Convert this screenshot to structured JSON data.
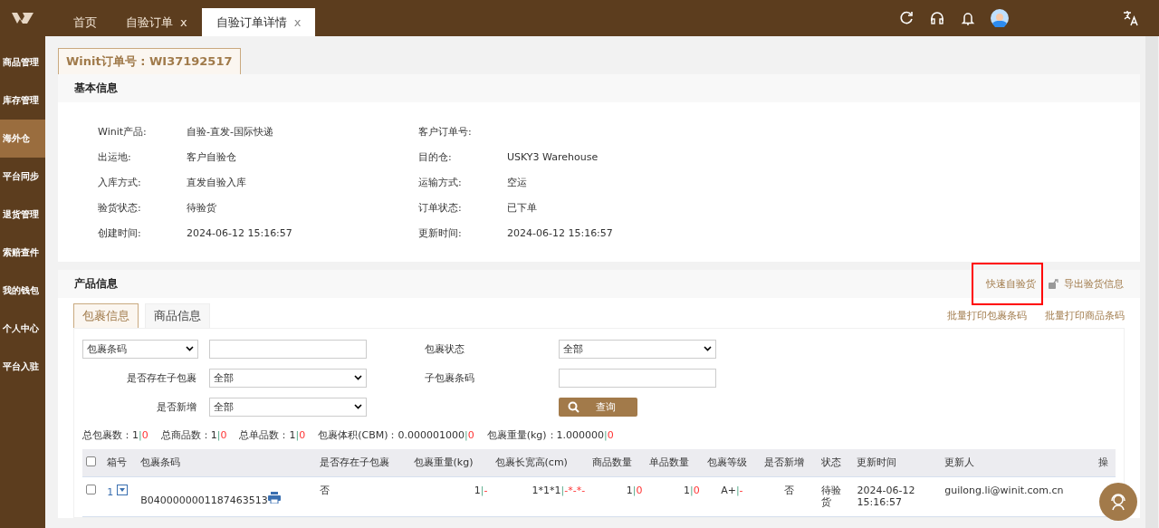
{
  "top_tabs": [
    {
      "label": "首页",
      "selected": false
    },
    {
      "label": "自验订单",
      "close": "x",
      "selected": false
    },
    {
      "label": "自验订单详情",
      "close": "x",
      "selected": true
    }
  ],
  "sidebar": {
    "items": [
      {
        "label": "商品管理",
        "selected": false
      },
      {
        "label": "库存管理",
        "selected": false
      },
      {
        "label": "海外仓",
        "selected": true
      },
      {
        "label": "平台同步",
        "selected": false
      },
      {
        "label": "退货管理",
        "selected": false
      },
      {
        "label": "索赔查件",
        "selected": false
      },
      {
        "label": "我的钱包",
        "selected": false
      },
      {
        "label": "个人中心",
        "selected": false
      },
      {
        "label": "平台入驻",
        "selected": false
      }
    ]
  },
  "order_tab": "Winit订单号 : WI37192517",
  "basic_info": {
    "title": "基本信息",
    "fields": [
      {
        "label": "Winit产品:",
        "value": "自验-直发-国际快递"
      },
      {
        "label": "客户订单号:"
      },
      {
        "label": "出运地:",
        "value": "客户自验仓"
      },
      {
        "label": "目的仓:",
        "value": "USKY3 Warehouse"
      },
      {
        "label": "入库方式:",
        "value": "直发自验入库"
      },
      {
        "label": "运输方式:",
        "value": "空运"
      },
      {
        "label": "验货状态:",
        "value": "待验货"
      },
      {
        "label": "订单状态:",
        "value": "已下单"
      },
      {
        "label": "创建时间:",
        "value": "2024-06-12 15:16:57"
      },
      {
        "label": "更新时间:",
        "value": "2024-06-12 15:16:57"
      }
    ]
  },
  "product_info": {
    "title": "产品信息",
    "actions": [
      {
        "label": "快速自验货",
        "kind": "plain",
        "highlighted": true
      },
      {
        "label": "导出验货信息",
        "kind": "export",
        "highlighted": false
      }
    ],
    "sub_tabs": [
      {
        "label": "包裹信息",
        "selected": true
      },
      {
        "label": "商品信息",
        "selected": false
      }
    ],
    "print_links": [
      "批量打印包裹条码",
      "批量打印商品条码"
    ],
    "filters": {
      "search_type": "包裹条码",
      "package_status_label": "包裹状态",
      "package_status": "全部",
      "has_sub_label": "是否存在子包裹",
      "has_sub": "全部",
      "sub_barcode_label": "子包裹条码",
      "is_new_label": "是否新增",
      "is_new": "全部",
      "query_button": "查询"
    },
    "stats": [
      {
        "label": "总包裹数：",
        "value": "1",
        "sep": "|",
        "delta": "0"
      },
      {
        "label": "总商品数：",
        "value": "1",
        "sep": "|",
        "delta": "0"
      },
      {
        "label": "总单品数：",
        "value": "1",
        "sep": "|",
        "delta": "0"
      },
      {
        "label": "包裹体积(CBM)：",
        "value": "0.000001000",
        "sep": "|",
        "delta": "0"
      },
      {
        "label": "包裹重量(kg)：",
        "value": "1.000000",
        "sep": "|",
        "delta": "0"
      }
    ],
    "table": {
      "select_all_checked": false,
      "columns": [
        "箱号",
        "包裹条码",
        "是否存在子包裹",
        "包裹重量(kg)",
        "包裹长宽高(cm)",
        "商品数量",
        "单品数量",
        "包裹等级",
        "是否新增",
        "状态",
        "更新时间",
        "更新人",
        "操"
      ],
      "rows": [
        {
          "checked": false,
          "box_no": "1",
          "barcode": "B0400000001187463513",
          "has_sub": "否",
          "weight": {
            "value": "1",
            "sep": "|",
            "delta": "-"
          },
          "dims": {
            "value": "1*1*1",
            "sep": "|",
            "delta": "-*-*-"
          },
          "goods_qty": {
            "value": "1",
            "sep": "|",
            "delta": "0"
          },
          "item_qty": {
            "value": "1",
            "sep": "|",
            "delta": "0"
          },
          "grade": {
            "value": "A+",
            "sep": "|",
            "delta": "-"
          },
          "is_new": "否",
          "status": "待验货",
          "updated_at": "2024-06-12 15:16:57",
          "updated_by": "guilong.li@winit.com.cn"
        }
      ]
    }
  }
}
